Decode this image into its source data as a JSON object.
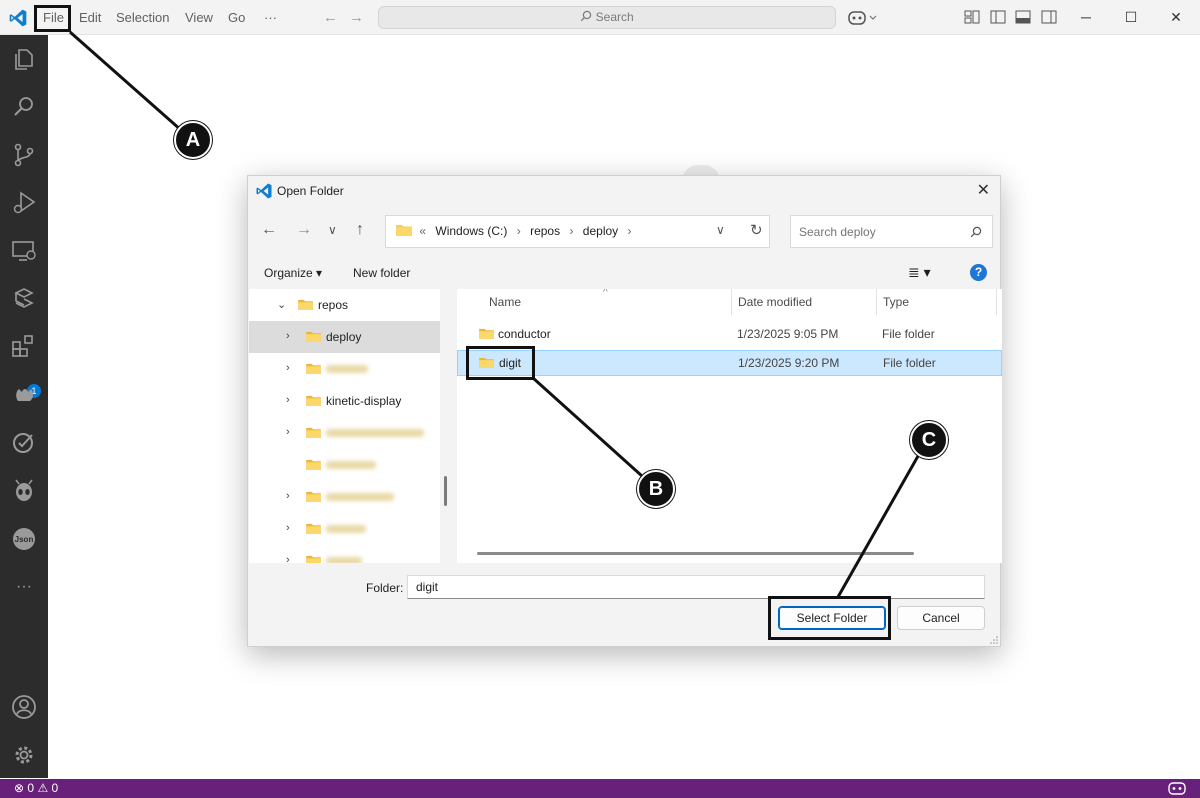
{
  "titlebar": {
    "menu": [
      "File",
      "Edit",
      "Selection",
      "View",
      "Go",
      "···"
    ],
    "search_label": "Search"
  },
  "activitybar": {
    "icons": [
      "explorer-icon",
      "search-icon",
      "source-control-icon",
      "run-debug-icon",
      "remote-explorer-icon",
      "testing-icon",
      "extensions-icon",
      "copilot-chat-icon",
      "checklist-icon",
      "alien-icon",
      "json-icon",
      "more-icon",
      "account-icon",
      "settings-icon"
    ],
    "extensions_badge": "1",
    "json_label": "Json",
    "more_label": "···"
  },
  "statusbar": {
    "errors": "0",
    "warnings": "0"
  },
  "dialog": {
    "title": "Open Folder",
    "close": "✕",
    "address": {
      "prefix": "«",
      "crumbs": [
        "Windows (C:)",
        "repos",
        "deploy"
      ]
    },
    "search_placeholder": "Search deploy",
    "toolbar": {
      "organize": "Organize ▾",
      "new_folder": "New folder",
      "help": "?"
    },
    "tree": {
      "root": "repos",
      "items": [
        {
          "label": "deploy",
          "expandable": true,
          "selected": true,
          "blurred": false
        },
        {
          "label": "",
          "expandable": true,
          "selected": false,
          "blurred": true
        },
        {
          "label": "kinetic-display",
          "expandable": true,
          "selected": false,
          "blurred": false
        },
        {
          "label": "",
          "expandable": true,
          "selected": false,
          "blurred": true
        },
        {
          "label": "",
          "expandable": false,
          "selected": false,
          "blurred": true
        },
        {
          "label": "",
          "expandable": true,
          "selected": false,
          "blurred": true
        },
        {
          "label": "",
          "expandable": true,
          "selected": false,
          "blurred": true
        },
        {
          "label": "",
          "expandable": true,
          "selected": false,
          "blurred": true
        }
      ]
    },
    "columns": [
      "Name",
      "Date modified",
      "Type"
    ],
    "files": [
      {
        "name": "conductor",
        "date": "1/23/2025 9:05 PM",
        "type": "File folder",
        "selected": false
      },
      {
        "name": "digit",
        "date": "1/23/2025 9:20 PM",
        "type": "File folder",
        "selected": true
      }
    ],
    "folder_label": "Folder:",
    "folder_value": "digit",
    "select_button": "Select Folder",
    "cancel_button": "Cancel"
  },
  "annotations": [
    "A",
    "B",
    "C"
  ],
  "colors": {
    "activity_bar": "#2c2c2c",
    "status_bar": "#68217a",
    "accent": "#0078d4",
    "selection": "#cce8ff",
    "folder": "#f8cf5a"
  }
}
